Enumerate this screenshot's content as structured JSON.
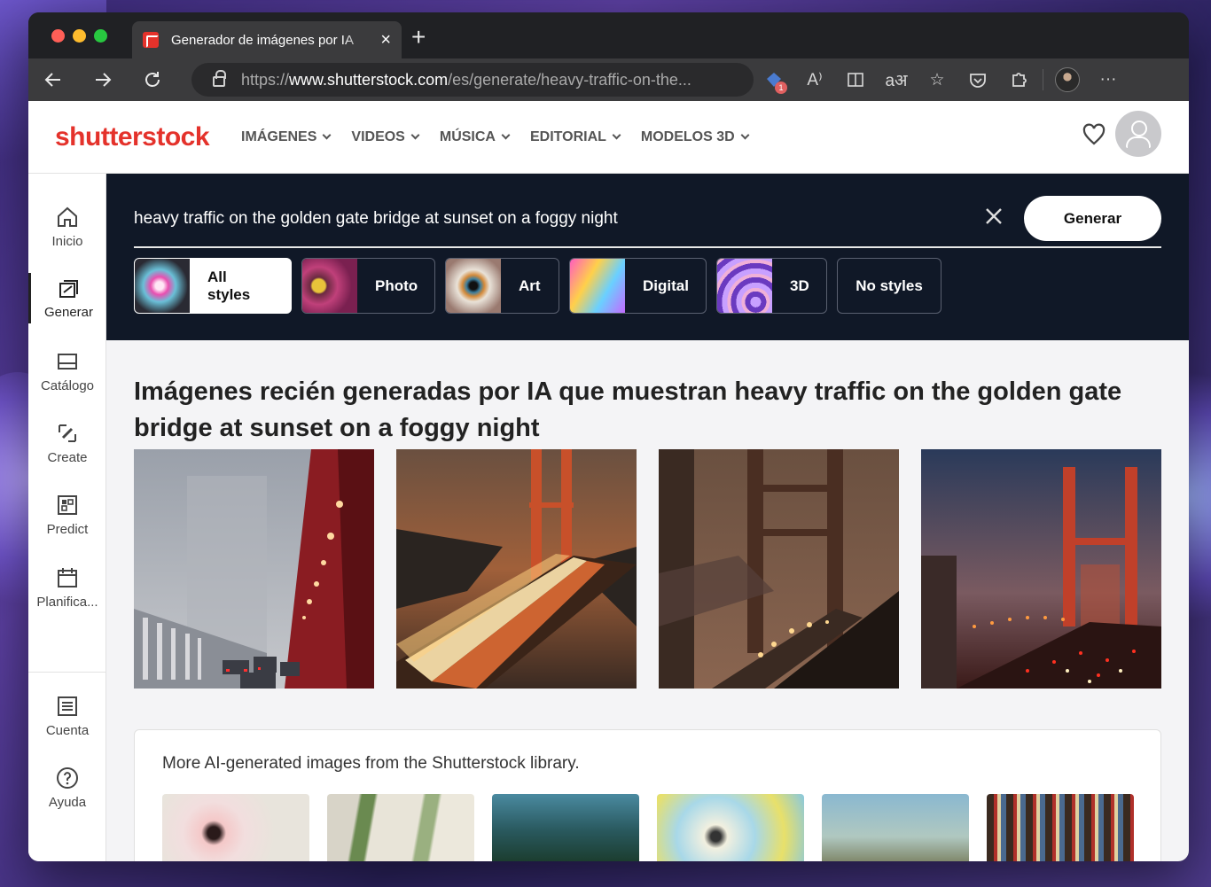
{
  "browser": {
    "tab_title": "Generador de imágenes por IA",
    "url_prefix": "https://",
    "url_host": "www.shutterstock.com",
    "url_path": "/es/generate/heavy-traffic-on-the...",
    "extension_badge": "1",
    "read_aloud_glyph": "A⁾",
    "translate_glyph": "aअ"
  },
  "site": {
    "logo": "shutterstock",
    "nav": [
      {
        "label": "IMÁGENES"
      },
      {
        "label": "VIDEOS"
      },
      {
        "label": "MÚSICA"
      },
      {
        "label": "EDITORIAL"
      },
      {
        "label": "MODELOS 3D"
      }
    ]
  },
  "sidebar": {
    "items": [
      {
        "label": "Inicio",
        "icon": "home-icon"
      },
      {
        "label": "Generar",
        "icon": "generate-icon"
      },
      {
        "label": "Catálogo",
        "icon": "catalog-icon"
      },
      {
        "label": "Create",
        "icon": "create-icon"
      },
      {
        "label": "Predict",
        "icon": "predict-icon"
      },
      {
        "label": "Planifica...",
        "icon": "calendar-icon"
      },
      {
        "label": "Cuenta",
        "icon": "account-icon"
      },
      {
        "label": "Ayuda",
        "icon": "help-icon"
      }
    ]
  },
  "generator": {
    "prompt": "heavy traffic on the golden gate bridge at sunset on a foggy night",
    "generate_label": "Generar",
    "styles": [
      {
        "label": "All styles",
        "active": true
      },
      {
        "label": "Photo",
        "active": false
      },
      {
        "label": "Art",
        "active": false
      },
      {
        "label": "Digital",
        "active": false
      },
      {
        "label": "3D",
        "active": false
      },
      {
        "label": "No styles",
        "active": false
      }
    ]
  },
  "results": {
    "title": "Imágenes recién generadas por IA que muestran heavy traffic on the golden gate bridge at sunset on a foggy night"
  },
  "more": {
    "title": "More AI-generated images from the Shutterstock library."
  },
  "colors": {
    "brand": "#e4322b",
    "hero_bg": "#101827"
  }
}
